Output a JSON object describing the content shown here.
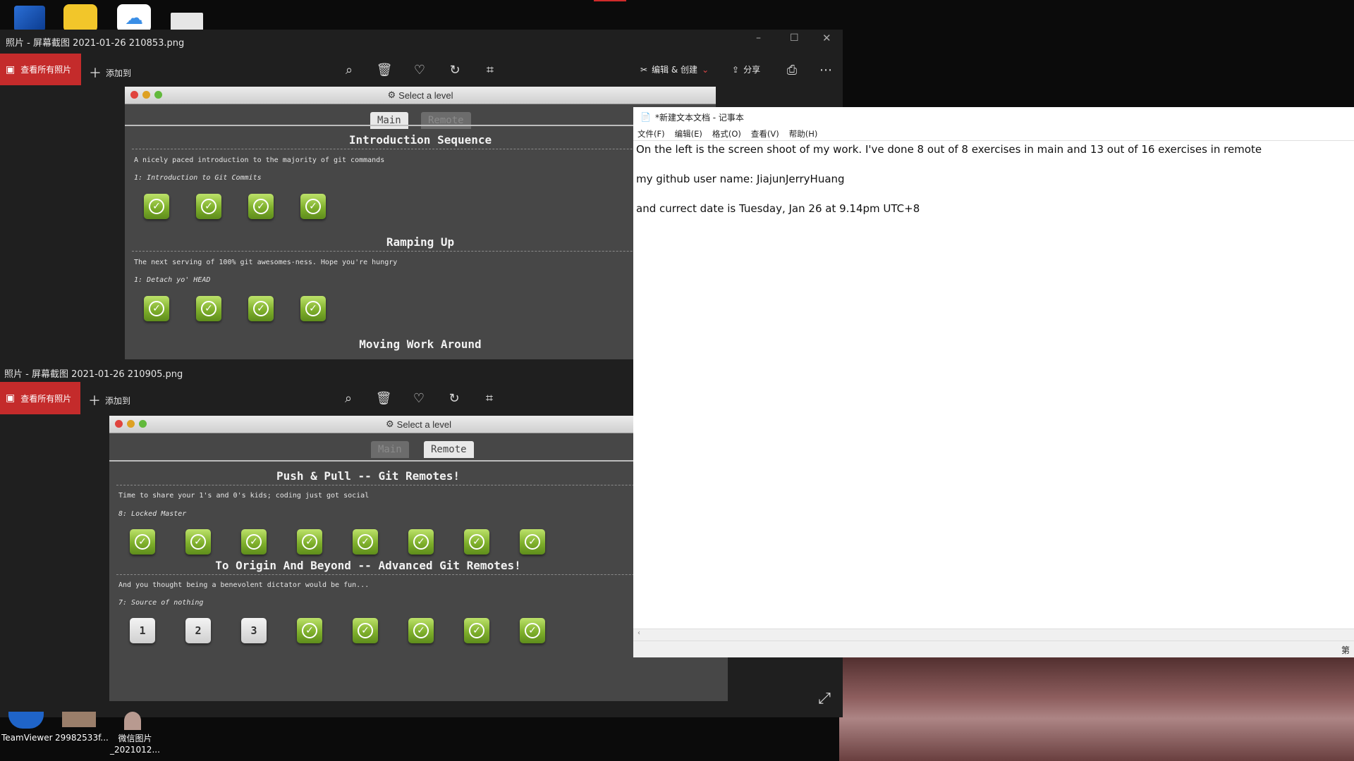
{
  "desktop": {
    "icons_bottom": [
      {
        "label": "TeamViewer",
        "icon": "teamviewer-icon"
      },
      {
        "label": "29982533f...",
        "icon": "image-file-icon"
      },
      {
        "label": "微信图片\n_2021012...",
        "icon": "image-file-icon"
      }
    ]
  },
  "photos_window_1": {
    "title": "照片 - 屏幕截图 2021-01-26 210853.png",
    "view_all_label": "查看所有照片",
    "add_label": "添加到",
    "edit_label": "编辑 & 创建",
    "share_label": "分享",
    "level_window": {
      "title": "Select a level",
      "tabs": [
        {
          "label": "Main",
          "active": true
        },
        {
          "label": "Remote",
          "active": false
        }
      ],
      "sections": [
        {
          "heading": "Introduction Sequence",
          "desc": "A nicely paced introduction to the majority of git commands",
          "sub": "1: Introduction to Git Commits",
          "levels": [
            "done",
            "done",
            "done",
            "done"
          ]
        },
        {
          "heading": "Ramping Up",
          "desc": "The next serving of 100% git awesomes-ness. Hope you're hungry",
          "sub": "1: Detach yo' HEAD",
          "levels": [
            "done",
            "done",
            "done",
            "done"
          ]
        },
        {
          "heading": "Moving Work Around"
        }
      ]
    }
  },
  "photos_window_2": {
    "title": "照片 - 屏幕截图 2021-01-26 210905.png",
    "view_all_label": "查看所有照片",
    "add_label": "添加到",
    "level_window": {
      "title": "Select a level",
      "tabs": [
        {
          "label": "Main",
          "active": false
        },
        {
          "label": "Remote",
          "active": true
        }
      ],
      "sections": [
        {
          "heading": "Push & Pull -- Git Remotes!",
          "desc": "Time to share your 1's and 0's kids; coding just got social",
          "sub": "8: Locked Master",
          "levels": [
            "done",
            "done",
            "done",
            "done",
            "done",
            "done",
            "done",
            "done"
          ]
        },
        {
          "heading": "To Origin And Beyond -- Advanced Git Remotes!",
          "desc": "And you thought being a benevolent dictator would be fun...",
          "sub": "7: Source of nothing",
          "levels": [
            "1",
            "2",
            "3",
            "done",
            "done",
            "done",
            "done",
            "done"
          ]
        }
      ]
    }
  },
  "notepad": {
    "title": "*新建文本文档 - 记事本",
    "menu": [
      "文件(F)",
      "编辑(E)",
      "格式(O)",
      "查看(V)",
      "帮助(H)"
    ],
    "lines": [
      "On the left is the screen shoot of my work. I've done 8 out of 8 exercises in main and 13 out of 16 exercises in remote",
      "my github user name: JiajunJerryHuang",
      "and currect date is Tuesday, Jan 26 at 9.14pm UTC+8"
    ],
    "status_char": "第"
  }
}
